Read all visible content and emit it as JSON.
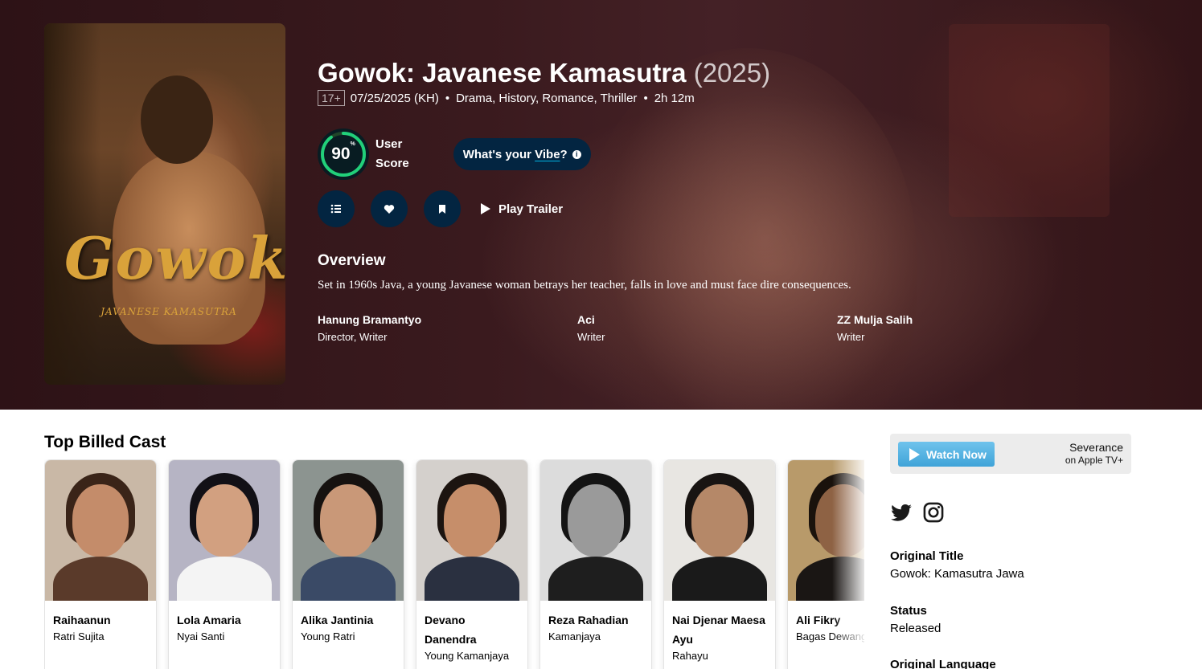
{
  "movie": {
    "title": "Gowok: Javanese Kamasutra",
    "year": "(2025)",
    "certification": "17+",
    "release": "07/25/2025 (KH)",
    "genres": "Drama, History, Romance, Thriller",
    "runtime": "2h 12m",
    "poster_title": "Gowok",
    "poster_subtitle": "JAVANESE KAMASUTRA"
  },
  "score": {
    "value": "90",
    "percent_sign": "%",
    "label_line1": "User",
    "label_line2": "Score",
    "percent": 90,
    "ring_color": "#21d07a"
  },
  "vibe": {
    "prefix": "What's your ",
    "word": "Vibe",
    "suffix": "?",
    "info_icon": "i"
  },
  "actions": {
    "list_icon": "list-icon",
    "favorite_icon": "heart-icon",
    "watchlist_icon": "bookmark-icon",
    "trailer_label": "Play Trailer"
  },
  "overview": {
    "heading": "Overview",
    "text": "Set in 1960s Java, a young Javanese woman betrays her teacher, falls in love and must face dire consequences."
  },
  "crew": [
    {
      "name": "Hanung Bramantyo",
      "role": "Director, Writer"
    },
    {
      "name": "Aci",
      "role": "Writer"
    },
    {
      "name": "ZZ Mulja Salih",
      "role": "Writer"
    }
  ],
  "cast": {
    "heading": "Top Billed Cast",
    "members": [
      {
        "name": "Raihaanun",
        "character": "Ratri Sujita"
      },
      {
        "name": "Lola Amaria",
        "character": "Nyai Santi"
      },
      {
        "name": "Alika Jantinia",
        "character": "Young Ratri"
      },
      {
        "name": "Devano Danendra",
        "character": "Young Kamanjaya"
      },
      {
        "name": "Reza Rahadian",
        "character": "Kamanjaya"
      },
      {
        "name": "Nai Djenar Maesa Ayu",
        "character": "Rahayu"
      },
      {
        "name": "Ali Fikry",
        "character": "Bagas Dewangga"
      }
    ]
  },
  "sidebar": {
    "watch_button": "Watch Now",
    "promo_title": "Severance",
    "promo_subtitle": "on Apple TV+",
    "social": [
      "twitter-icon",
      "instagram-icon"
    ],
    "facts": [
      {
        "label": "Original Title",
        "value": "Gowok: Kamasutra Jawa"
      },
      {
        "label": "Status",
        "value": "Released"
      },
      {
        "label": "Original Language",
        "value": ""
      }
    ]
  },
  "colors": {
    "hero_bg": "#3a1a1e",
    "navy": "#032541",
    "accent_blue": "#01b4e4",
    "score_green": "#21d07a",
    "watch_blue": "#3fa3d8"
  }
}
